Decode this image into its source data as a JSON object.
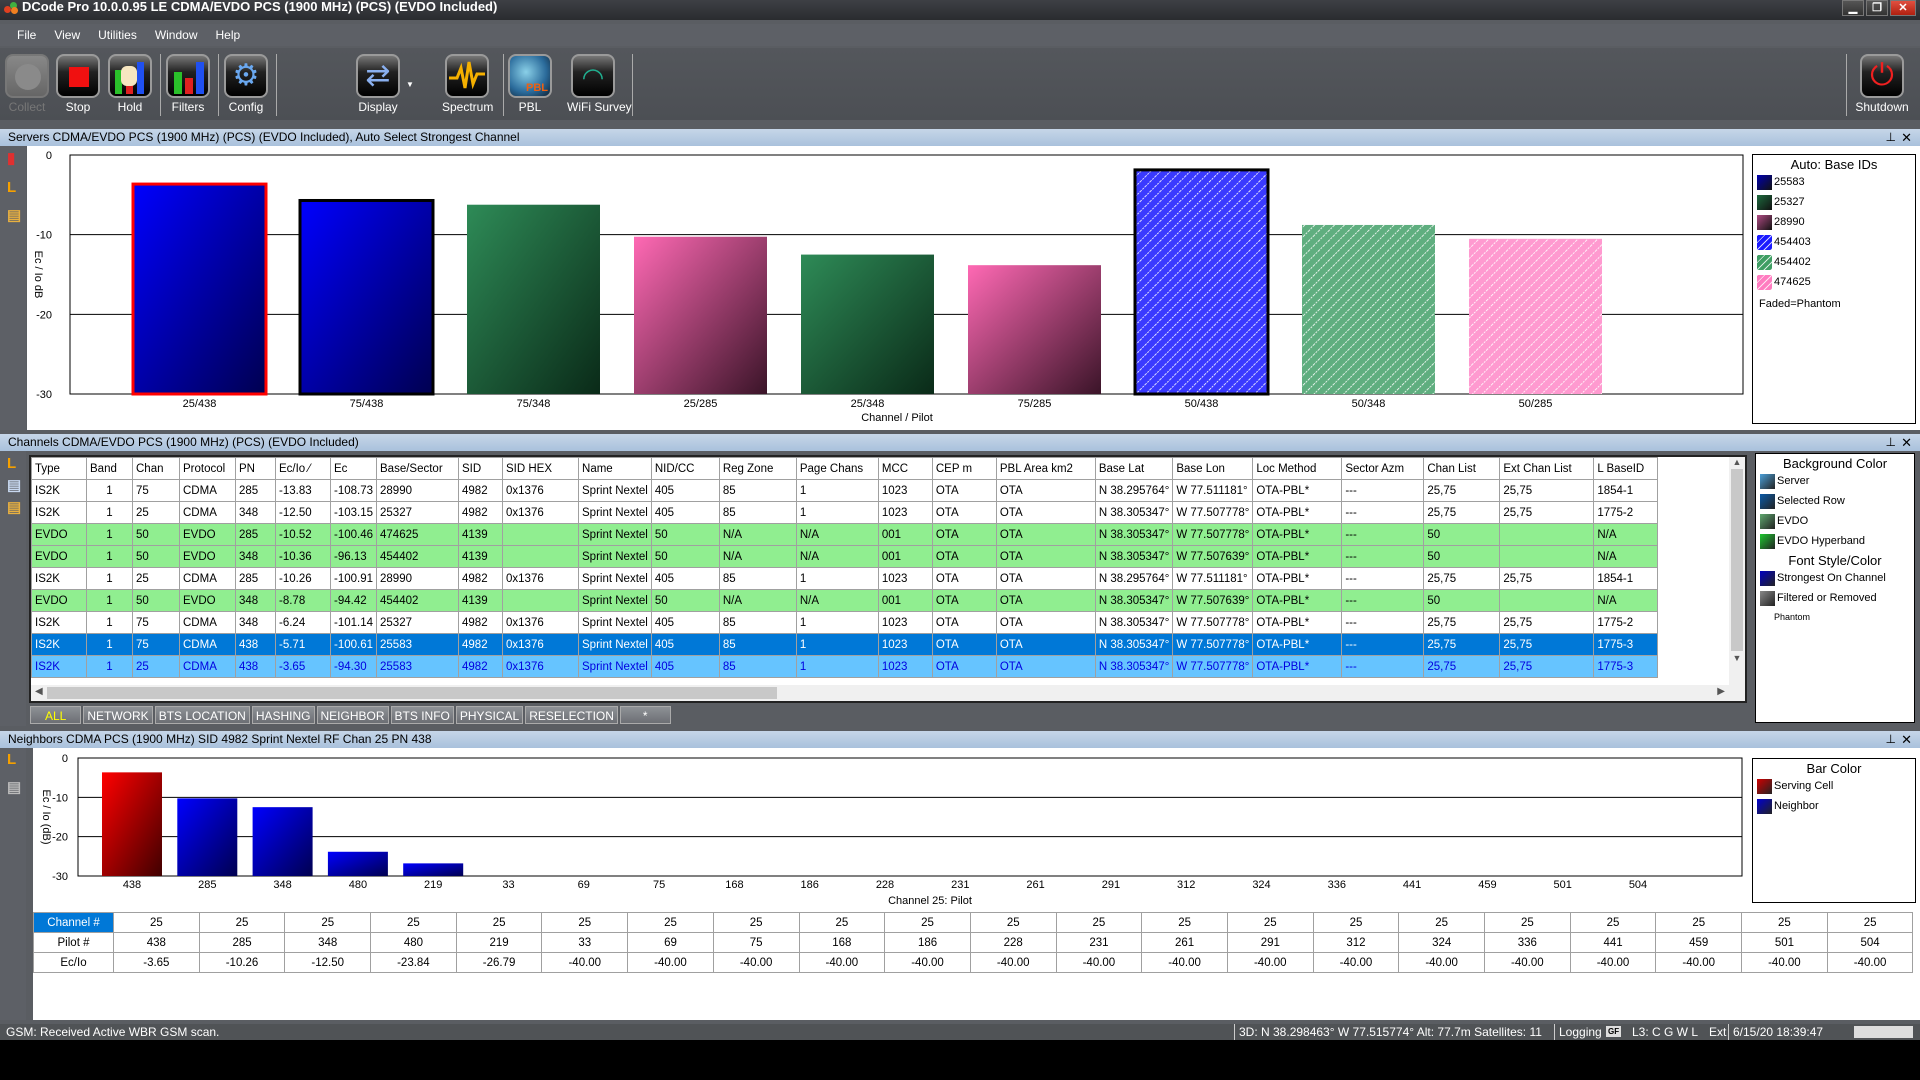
{
  "window": {
    "title": "DCode Pro 10.0.0.95 LE  CDMA/EVDO PCS (1900 MHz) (PCS) (EVDO Included)",
    "controls": [
      "minimize",
      "restore",
      "close"
    ]
  },
  "menu": [
    "File",
    "View",
    "Utilities",
    "Window",
    "Help"
  ],
  "toolbar": {
    "collect": "Collect",
    "stop": "Stop",
    "hold": "Hold",
    "filters": "Filters",
    "config": "Config",
    "display": "Display",
    "spectrum": "Spectrum",
    "pbl": "PBL",
    "wifi": "WiFi Survey",
    "shutdown": "Shutdown"
  },
  "servers_panel": {
    "title": "Servers CDMA/EVDO PCS (1900 MHz) (PCS) (EVDO Included),   Auto Select Strongest Channel",
    "legend": {
      "title": "Auto: Base IDs",
      "items": [
        {
          "label": "25583",
          "color": "#0000b0",
          "hatched": false
        },
        {
          "label": "25327",
          "color": "#1e6b3e",
          "hatched": false
        },
        {
          "label": "28990",
          "color": "#b04c84",
          "hatched": false
        },
        {
          "label": "454403",
          "color": "#1a1aff",
          "hatched": true
        },
        {
          "label": "454402",
          "color": "#3f9e63",
          "hatched": true
        },
        {
          "label": "474625",
          "color": "#ff7cc0",
          "hatched": true
        }
      ],
      "note": "Faded=Phantom"
    }
  },
  "chart_data": [
    {
      "type": "bar",
      "title": "",
      "xlabel": "Channel / Pilot",
      "ylabel": "Ec / Io dB",
      "ylim": [
        -30,
        0
      ],
      "yticks": [
        0,
        -10,
        -20,
        -30
      ],
      "grid": true,
      "legend_position": "right",
      "categories": [
        "25/438",
        "75/438",
        "75/348",
        "25/285",
        "25/348",
        "75/285",
        "50/438",
        "50/348",
        "50/285"
      ],
      "values": [
        -3.65,
        -5.71,
        -6.24,
        -10.26,
        -12.5,
        -13.83,
        -1.87,
        -8.78,
        -10.52
      ],
      "base_ids": [
        "25583",
        "25583",
        "25327",
        "28990",
        "25327",
        "28990",
        "454403",
        "454402",
        "474625"
      ],
      "colors": [
        "#0000ff",
        "#0000ff",
        "#2e8b57",
        "#ff69b4",
        "#2e8b57",
        "#ff69b4",
        "#3a3aff",
        "#5fae7f",
        "#ff9ad0"
      ],
      "hatched": [
        false,
        false,
        false,
        false,
        false,
        false,
        true,
        true,
        true
      ],
      "outline": [
        "serving",
        "strongest",
        "none",
        "none",
        "none",
        "none",
        "strongest",
        "none",
        "none"
      ]
    },
    {
      "type": "bar",
      "title": "",
      "xlabel": "Channel 25: Pilot",
      "ylabel": "Ec / Io (dB)",
      "ylim": [
        -30,
        0
      ],
      "yticks": [
        0,
        -10,
        -20,
        -30
      ],
      "grid": true,
      "legend_position": "right",
      "categories": [
        "438",
        "285",
        "348",
        "480",
        "219",
        "33",
        "69",
        "75",
        "168",
        "186",
        "228",
        "231",
        "261",
        "291",
        "312",
        "324",
        "336",
        "441",
        "459",
        "501",
        "504"
      ],
      "values": [
        -3.65,
        -10.26,
        -12.5,
        -23.84,
        -26.79,
        -40,
        -40,
        -40,
        -40,
        -40,
        -40,
        -40,
        -40,
        -40,
        -40,
        -40,
        -40,
        -40,
        -40,
        -40,
        -40
      ],
      "series_roles": [
        "serving",
        "neighbor",
        "neighbor",
        "neighbor",
        "neighbor",
        "neighbor",
        "neighbor",
        "neighbor",
        "neighbor",
        "neighbor",
        "neighbor",
        "neighbor",
        "neighbor",
        "neighbor",
        "neighbor",
        "neighbor",
        "neighbor",
        "neighbor",
        "neighbor",
        "neighbor",
        "neighbor"
      ]
    }
  ],
  "channels_panel": {
    "title": "Channels CDMA/EVDO PCS (1900 MHz) (PCS) (EVDO Included)",
    "columns": [
      "Type",
      "Band",
      "Chan",
      "Protocol",
      "PN",
      "Ec/Io",
      "Ec",
      "Base/Sector",
      "SID",
      "SID HEX",
      "Name",
      "NID/CC",
      "Reg Zone",
      "Page Chans",
      "MCC",
      "CEP m",
      "PBL Area km2",
      "Base Lat",
      "Base Lon",
      "Loc Method",
      "Sector Azm",
      "Chan List",
      "Ext Chan List",
      "L BaseID"
    ],
    "sort_indicator": "Ec/Io",
    "rows": [
      {
        "style": "white-row",
        "cells": [
          "IS2K",
          "1",
          "75",
          "CDMA",
          "285",
          "-13.83",
          "-108.73",
          "28990",
          "4982",
          "0x1376",
          "Sprint Nextel",
          "405",
          "85",
          "1",
          "1023",
          "OTA",
          "OTA",
          "N 38.295764°",
          "W 77.511181°",
          "OTA-PBL*",
          "---",
          "25,75",
          "25,75",
          "1854-1"
        ]
      },
      {
        "style": "white-row",
        "cells": [
          "IS2K",
          "1",
          "25",
          "CDMA",
          "348",
          "-12.50",
          "-103.15",
          "25327",
          "4982",
          "0x1376",
          "Sprint Nextel",
          "405",
          "85",
          "1",
          "1023",
          "OTA",
          "OTA",
          "N 38.305347°",
          "W 77.507778°",
          "OTA-PBL*",
          "---",
          "25,75",
          "25,75",
          "1775-2"
        ]
      },
      {
        "style": "evdo",
        "cells": [
          "EVDO",
          "1",
          "50",
          "EVDO",
          "285",
          "-10.52",
          "-100.46",
          "474625",
          "4139",
          "",
          "Sprint Nextel",
          "50",
          "N/A",
          "N/A",
          "001",
          "OTA",
          "OTA",
          "N 38.305347°",
          "W 77.507778°",
          "OTA-PBL*",
          "---",
          "50",
          "",
          "N/A"
        ]
      },
      {
        "style": "evdo",
        "cells": [
          "EVDO",
          "1",
          "50",
          "EVDO",
          "348",
          "-10.36",
          "-96.13",
          "454402",
          "4139",
          "",
          "Sprint Nextel",
          "50",
          "N/A",
          "N/A",
          "001",
          "OTA",
          "OTA",
          "N 38.305347°",
          "W 77.507639°",
          "OTA-PBL*",
          "---",
          "50",
          "",
          "N/A"
        ]
      },
      {
        "style": "white-row",
        "cells": [
          "IS2K",
          "1",
          "25",
          "CDMA",
          "285",
          "-10.26",
          "-100.91",
          "28990",
          "4982",
          "0x1376",
          "Sprint Nextel",
          "405",
          "85",
          "1",
          "1023",
          "OTA",
          "OTA",
          "N 38.295764°",
          "W 77.511181°",
          "OTA-PBL*",
          "---",
          "25,75",
          "25,75",
          "1854-1"
        ]
      },
      {
        "style": "evdo",
        "cells": [
          "EVDO",
          "1",
          "50",
          "EVDO",
          "348",
          "-8.78",
          "-94.42",
          "454402",
          "4139",
          "",
          "Sprint Nextel",
          "50",
          "N/A",
          "N/A",
          "001",
          "OTA",
          "OTA",
          "N 38.305347°",
          "W 77.507639°",
          "OTA-PBL*",
          "---",
          "50",
          "",
          "N/A"
        ]
      },
      {
        "style": "white-row",
        "cells": [
          "IS2K",
          "1",
          "75",
          "CDMA",
          "348",
          "-6.24",
          "-101.14",
          "25327",
          "4982",
          "0x1376",
          "Sprint Nextel",
          "405",
          "85",
          "1",
          "1023",
          "OTA",
          "OTA",
          "N 38.305347°",
          "W 77.507778°",
          "OTA-PBL*",
          "---",
          "25,75",
          "25,75",
          "1775-2"
        ]
      },
      {
        "style": "sel",
        "cells": [
          "IS2K",
          "1",
          "75",
          "CDMA",
          "438",
          "-5.71",
          "-100.61",
          "25583",
          "4982",
          "0x1376",
          "Sprint Nextel",
          "405",
          "85",
          "1",
          "1023",
          "OTA",
          "OTA",
          "N 38.305347°",
          "W 77.507778°",
          "OTA-PBL*",
          "---",
          "25,75",
          "25,75",
          "1775-3"
        ]
      },
      {
        "style": "server",
        "cells": [
          "IS2K",
          "1",
          "25",
          "CDMA",
          "438",
          "-3.65",
          "-94.30",
          "25583",
          "4982",
          "0x1376",
          "Sprint Nextel",
          "405",
          "85",
          "1",
          "1023",
          "OTA",
          "OTA",
          "N 38.305347°",
          "W 77.507778°",
          "OTA-PBL*",
          "---",
          "25,75",
          "25,75",
          "1775-3"
        ]
      }
    ],
    "tabs": [
      "ALL",
      "NETWORK",
      "BTS LOCATION",
      "HASHING",
      "NEIGHBOR",
      "BTS INFO",
      "PHYSICAL",
      "RESELECTION",
      "*"
    ],
    "active_tab": "ALL",
    "legend": {
      "bg_title": "Background Color",
      "bg_items": [
        {
          "label": "Server",
          "color": "#4a9fd8"
        },
        {
          "label": "Selected Row",
          "color": "#0a5aa8"
        },
        {
          "label": "EVDO",
          "color": "#5fa86f"
        },
        {
          "label": "EVDO Hyperband",
          "color": "#1ec830"
        }
      ],
      "font_title": "Font Style/Color",
      "font_items": [
        {
          "label": "Strongest On Channel",
          "color": "#0000c0"
        },
        {
          "label": "Filtered or Removed",
          "color": "#888888"
        }
      ],
      "phantom": "Phantom"
    }
  },
  "neighbors_panel": {
    "title": "Neighbors  CDMA PCS (1900 MHz)  SID 4982 Sprint Nextel RF Chan 25 PN 438",
    "legend": {
      "title": "Bar Color",
      "items": [
        {
          "label": "Serving Cell",
          "color": "#d00000"
        },
        {
          "label": "Neighbor",
          "color": "#0000d0"
        }
      ]
    },
    "table": {
      "row_headers": [
        "Channel #",
        "Pilot #",
        "Ec/Io"
      ],
      "channels": [
        "25",
        "25",
        "25",
        "25",
        "25",
        "25",
        "25",
        "25",
        "25",
        "25",
        "25",
        "25",
        "25",
        "25",
        "25",
        "25",
        "25",
        "25",
        "25",
        "25",
        "25"
      ],
      "pilots": [
        "438",
        "285",
        "348",
        "480",
        "219",
        "33",
        "69",
        "75",
        "168",
        "186",
        "228",
        "231",
        "261",
        "291",
        "312",
        "324",
        "336",
        "441",
        "459",
        "501",
        "504"
      ],
      "ecio": [
        "-3.65",
        "-10.26",
        "-12.50",
        "-23.84",
        "-26.79",
        "-40.00",
        "-40.00",
        "-40.00",
        "-40.00",
        "-40.00",
        "-40.00",
        "-40.00",
        "-40.00",
        "-40.00",
        "-40.00",
        "-40.00",
        "-40.00",
        "-40.00",
        "-40.00",
        "-40.00",
        "-40.00"
      ]
    }
  },
  "status": {
    "message": "GSM: Received Active WBR GSM scan.",
    "gps": "3D: N 38.298463°  W 77.515774°  Alt: 77.7m  Satellites: 11",
    "logging": "Logging",
    "gf_badge": "GF",
    "layers": "L3: C G W L",
    "ext": "Ext",
    "datetime": "6/15/20 18:39:47"
  }
}
